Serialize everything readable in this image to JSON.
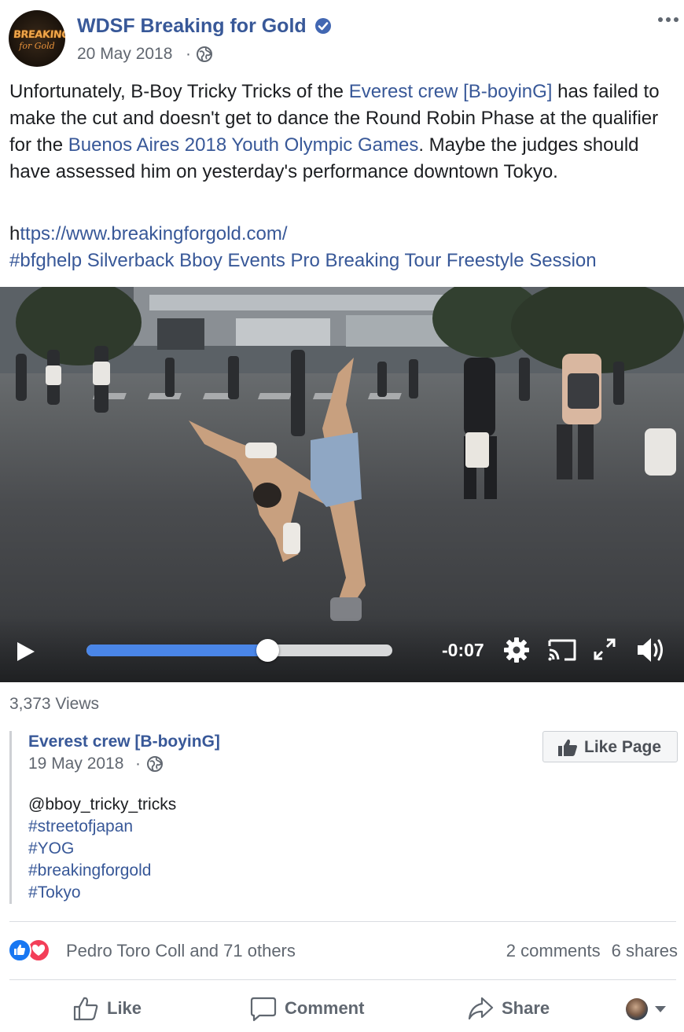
{
  "header": {
    "page_name": "WDSF Breaking for Gold",
    "date": "20 May 2018",
    "date_separator": "·",
    "avatar_logo_text_top": "BREAKING",
    "avatar_logo_text_bottom": "for Gold"
  },
  "post": {
    "text_before_link1": "Unfortunately, B-Boy Tricky Tricks of the ",
    "link1": "Everest crew [B-boyinG]",
    "text_after_link1": " has failed to make the cut and doesn't get to dance the Round Robin Phase at the qualifier for the ",
    "link2": "Buenos Aires 2018 Youth Olympic Games",
    "text_after_link2": ". Maybe the judges should have assessed him on yesterday's performance downtown Tokyo.",
    "url_prefix": "h",
    "url_link": "ttps://www.breakingforgold.com/",
    "hashtags_line": "#bfghelp Silverback Bboy Events Pro Breaking Tour Freestyle Session"
  },
  "video": {
    "time_remaining": "-0:07",
    "progress": 0.59
  },
  "views": "3,373 Views",
  "shared": {
    "name": "Everest crew [B-boyinG]",
    "date": "19 May 2018",
    "date_separator": "·",
    "like_page_label": "Like Page",
    "mention": "@bboy_tricky_tricks",
    "hashtags": [
      "#streetofjapan",
      "#YOG",
      "#breakingforgold",
      "#Tokyo"
    ]
  },
  "reactions": {
    "reactors": "Pedro Toro Coll and 71 others",
    "comments": "2 comments",
    "shares": "6 shares"
  },
  "actions": {
    "like": "Like",
    "comment": "Comment",
    "share": "Share"
  },
  "colors": {
    "link": "#385898",
    "progress": "#4a86e8",
    "like_reaction": "#1877f2",
    "love_reaction": "#f33e58"
  }
}
